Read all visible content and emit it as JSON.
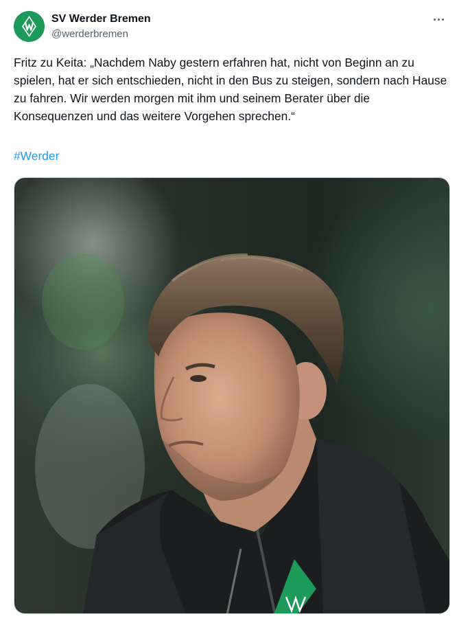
{
  "account": {
    "display_name": "SV Werder Bremen",
    "handle": "@werderbremen",
    "avatar_icon": "werder-diamond-logo"
  },
  "menu": {
    "icon": "more-horizontal-icon"
  },
  "tweet": {
    "text": "Fritz zu Keita: „Nachdem Naby gestern erfahren hat, nicht von Beginn an zu spielen, hat er sich entschieden, nicht in den Bus zu steigen, sondern nach Hause zu fahren. Wir werden morgen mit ihm und seinem Berater über die Konsequenzen und das weitere Vorgehen sprechen.“",
    "hashtag": "#Werder"
  },
  "colors": {
    "werder_green": "#1d9a5a",
    "link_blue": "#1d9bf0",
    "secondary_text": "#536471"
  }
}
